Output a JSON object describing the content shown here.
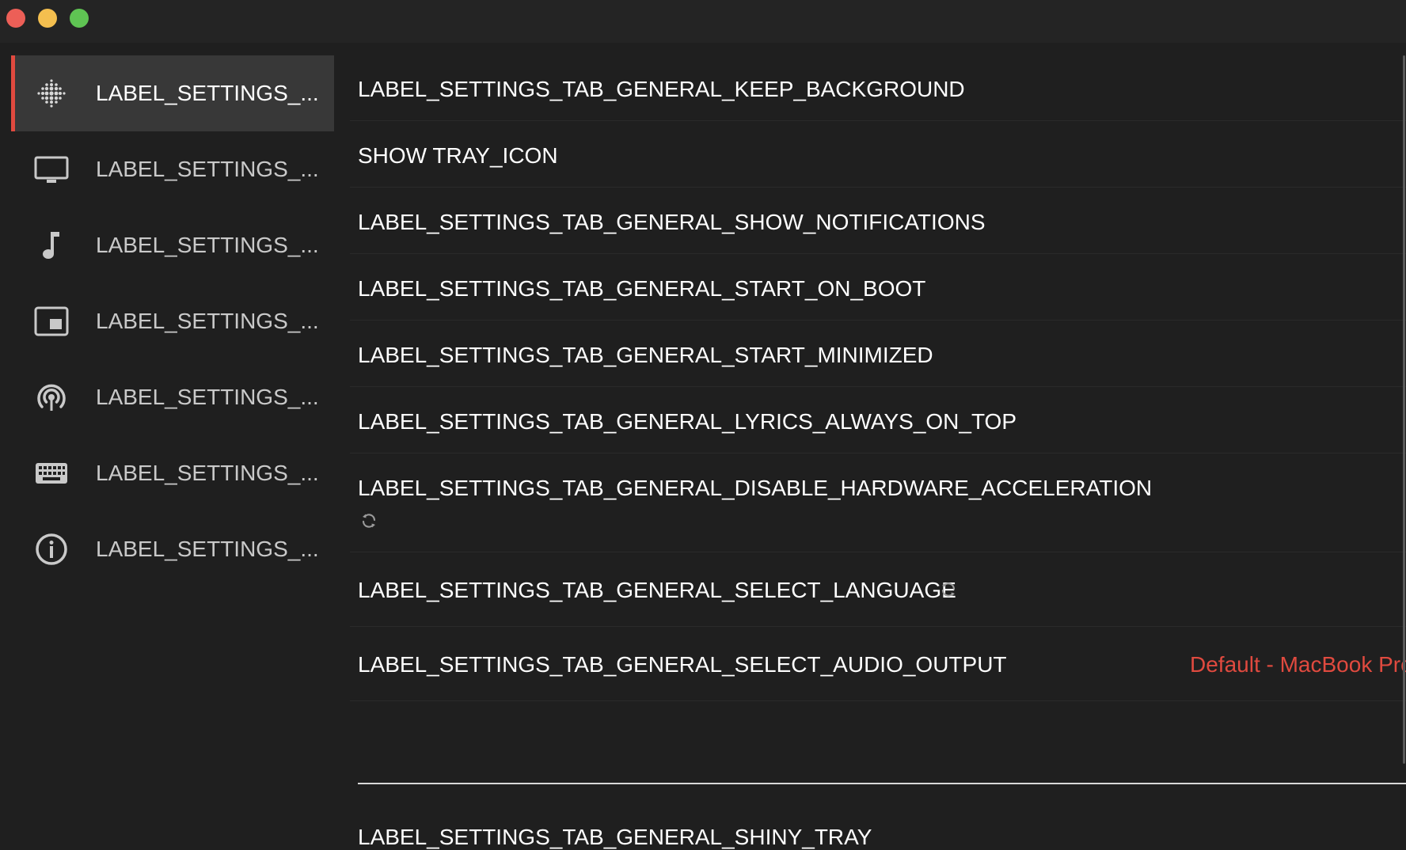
{
  "window": {
    "title": ""
  },
  "sidebar": {
    "items": [
      {
        "icon": "equalizer-dots-icon",
        "label": "LABEL_SETTINGS_...",
        "active": true
      },
      {
        "icon": "monitor-icon",
        "label": "LABEL_SETTINGS_...",
        "active": false
      },
      {
        "icon": "music-note-icon",
        "label": "LABEL_SETTINGS_...",
        "active": false
      },
      {
        "icon": "picture-in-picture-icon",
        "label": "LABEL_SETTINGS_...",
        "active": false
      },
      {
        "icon": "podcast-broadcast-icon",
        "label": "LABEL_SETTINGS_...",
        "active": false
      },
      {
        "icon": "keyboard-icon",
        "label": "LABEL_SETTINGS_...",
        "active": false
      },
      {
        "icon": "info-icon",
        "label": "LABEL_SETTINGS_...",
        "active": false
      }
    ]
  },
  "settings": {
    "keep_background": "LABEL_SETTINGS_TAB_GENERAL_KEEP_BACKGROUND",
    "show_tray_icon": "SHOW TRAY_ICON",
    "show_notifications": "LABEL_SETTINGS_TAB_GENERAL_SHOW_NOTIFICATIONS",
    "start_on_boot": "LABEL_SETTINGS_TAB_GENERAL_START_ON_BOOT",
    "start_minimized": "LABEL_SETTINGS_TAB_GENERAL_START_MINIMIZED",
    "lyrics_always_on_top": "LABEL_SETTINGS_TAB_GENERAL_LYRICS_ALWAYS_ON_TOP",
    "disable_hw_accel": "LABEL_SETTINGS_TAB_GENERAL_DISABLE_HARDWARE_ACCELERATION",
    "select_language": "LABEL_SETTINGS_TAB_GENERAL_SELECT_LANGUAGE",
    "select_audio_output": "LABEL_SETTINGS_TAB_GENERAL_SELECT_AUDIO_OUTPUT",
    "audio_output_value": "Default - MacBook Pro",
    "shiny_tray": "LABEL_SETTINGS_TAB_GENERAL_SHINY_TRAY"
  },
  "colors": {
    "accent": "#e04a3f",
    "background": "#1f1f1f",
    "sidebar_active": "#383838"
  }
}
